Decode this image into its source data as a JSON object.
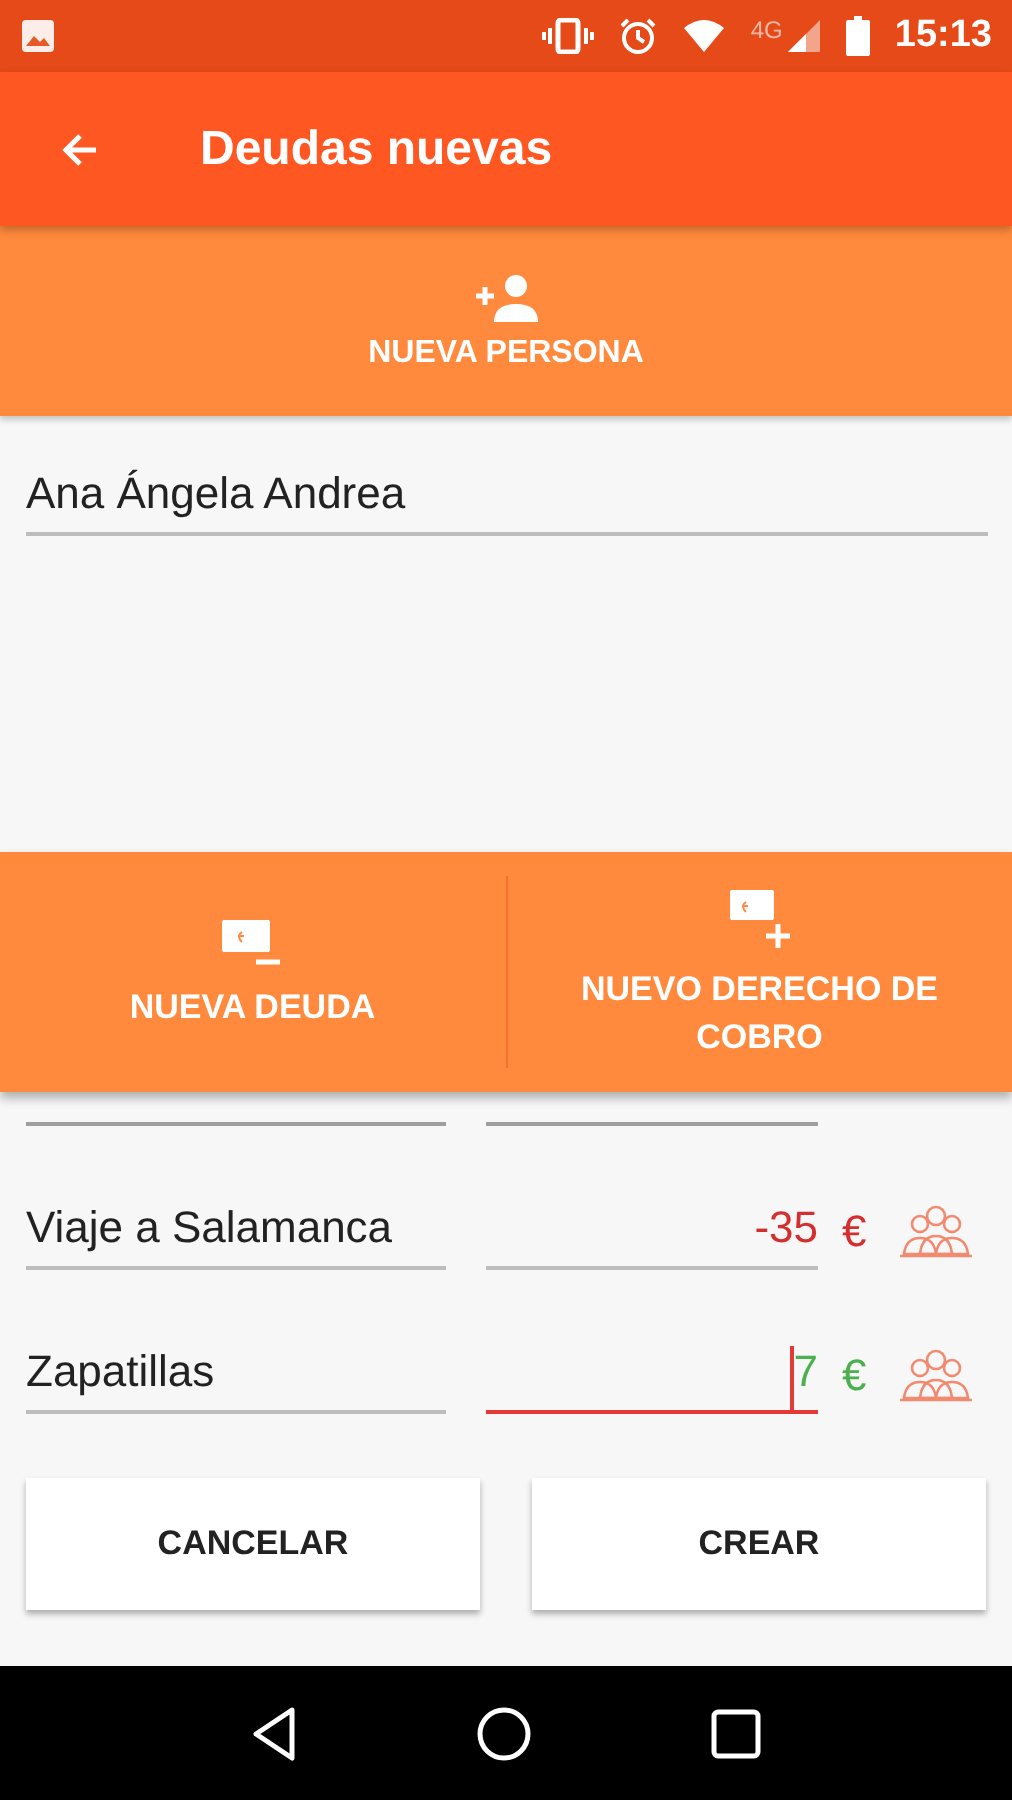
{
  "status_bar": {
    "time": "15:13",
    "network": "4G"
  },
  "toolbar": {
    "title": "Deudas nuevas"
  },
  "new_person_button": {
    "label": "NUEVA PERSONA"
  },
  "person_field": {
    "value": "Ana Ángela Andrea"
  },
  "debts": [
    {
      "concept": "Viaje a Salamanca",
      "amount": "-35",
      "currency": "€",
      "kind": "debt",
      "focused": false
    },
    {
      "concept": "Zapatillas",
      "amount": "7",
      "currency": "€",
      "kind": "credit",
      "focused": true
    }
  ],
  "action_bar": [
    {
      "kind": "debt",
      "label": "NUEVA DEUDA"
    },
    {
      "kind": "credit",
      "label": "NUEVO DERECHO DE COBRO"
    }
  ],
  "buttons": [
    "CANCELAR",
    "CREAR"
  ]
}
